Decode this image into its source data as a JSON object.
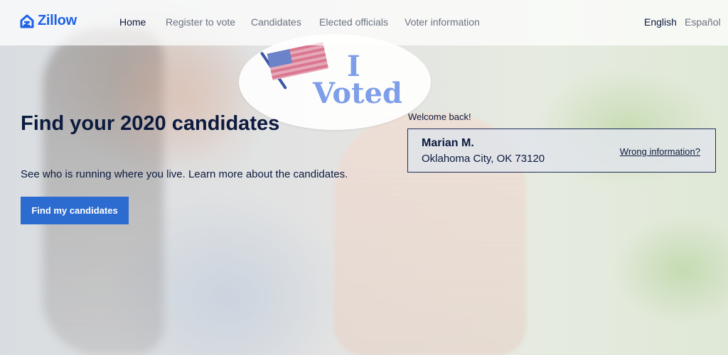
{
  "brand": {
    "name": "Zillow",
    "icon": "zillow-house-icon",
    "color": "#1e63e6"
  },
  "nav": {
    "items": [
      {
        "label": "Home",
        "active": true
      },
      {
        "label": "Register to vote",
        "active": false
      },
      {
        "label": "Candidates",
        "active": false
      },
      {
        "label": "Elected officials",
        "active": false
      },
      {
        "label": "Voter information",
        "active": false
      }
    ],
    "languages": [
      {
        "label": "English",
        "active": true
      },
      {
        "label": "Español",
        "active": false
      }
    ]
  },
  "hero": {
    "sticker_i": "I",
    "sticker_voted": "Voted",
    "title": "Find your 2020 candidates",
    "subtitle": "See who is running where you live. Learn more about the candidates.",
    "cta_label": "Find my candidates",
    "cta_color": "#2c6bd0"
  },
  "user": {
    "welcome": "Welcome back!",
    "name": "Marian M.",
    "location": "Oklahoma City, OK 73120",
    "wrong_info_link": "Wrong information?"
  }
}
